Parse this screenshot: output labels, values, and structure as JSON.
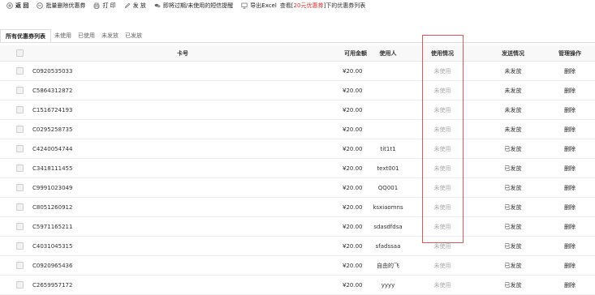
{
  "toolbar": {
    "back": "返 回",
    "batch_delete": "批量删除优惠券",
    "print": "打 印",
    "distribute": "发 放",
    "sms_reminder": "即将过期/未使用的短信提醒",
    "export_excel": "导出Excel",
    "caption_prefix": "查看[",
    "caption_highlight": "20元优惠券",
    "caption_suffix": "]下的优惠券列表"
  },
  "tabs": [
    {
      "label": "所有优惠券列表",
      "active": true
    },
    {
      "label": "未使用",
      "active": false
    },
    {
      "label": "已使用",
      "active": false
    },
    {
      "label": "未发放",
      "active": false
    },
    {
      "label": "已发放",
      "active": false
    }
  ],
  "columns": {
    "card_no": "卡号",
    "amount": "可用金额",
    "user": "使用人",
    "usage": "使用情况",
    "send_status": "发送情况",
    "manage": "管理操作"
  },
  "rows": [
    {
      "card": "C0920535033",
      "amount": "¥20.00",
      "user": "",
      "usage": "未使用",
      "send": "未发放",
      "action": "删除"
    },
    {
      "card": "C5864312872",
      "amount": "¥20.00",
      "user": "",
      "usage": "未使用",
      "send": "未发放",
      "action": "删除"
    },
    {
      "card": "C1516724193",
      "amount": "¥20.00",
      "user": "",
      "usage": "未使用",
      "send": "未发放",
      "action": "删除"
    },
    {
      "card": "C0295258735",
      "amount": "¥20.00",
      "user": "",
      "usage": "未使用",
      "send": "未发放",
      "action": "删除"
    },
    {
      "card": "C4240054744",
      "amount": "¥20.00",
      "user": "tit1t1",
      "usage": "未使用",
      "send": "已发放",
      "action": "删除"
    },
    {
      "card": "C3418111455",
      "amount": "¥20.00",
      "user": "text001",
      "usage": "未使用",
      "send": "已发放",
      "action": "删除"
    },
    {
      "card": "C9991023049",
      "amount": "¥20.00",
      "user": "QQ001",
      "usage": "未使用",
      "send": "已发放",
      "action": "删除"
    },
    {
      "card": "C8051260912",
      "amount": "¥20.00",
      "user": "ksxiaomns",
      "usage": "未使用",
      "send": "已发放",
      "action": "删除"
    },
    {
      "card": "C5971165211",
      "amount": "¥20.00",
      "user": "sdasdfdsa",
      "usage": "未使用",
      "send": "已发放",
      "action": "删除"
    },
    {
      "card": "C4031045315",
      "amount": "¥20.00",
      "user": "sfadssaa",
      "usage": "未使用",
      "send": "已发放",
      "action": "删除"
    },
    {
      "card": "C0920965436",
      "amount": "¥20.00",
      "user": "自由的飞",
      "usage": "未使用",
      "send": "已发放",
      "action": "删除"
    },
    {
      "card": "C2659957172",
      "amount": "¥20.00",
      "user": "yyyy",
      "usage": "未使用",
      "send": "已发放",
      "action": "删除"
    }
  ]
}
